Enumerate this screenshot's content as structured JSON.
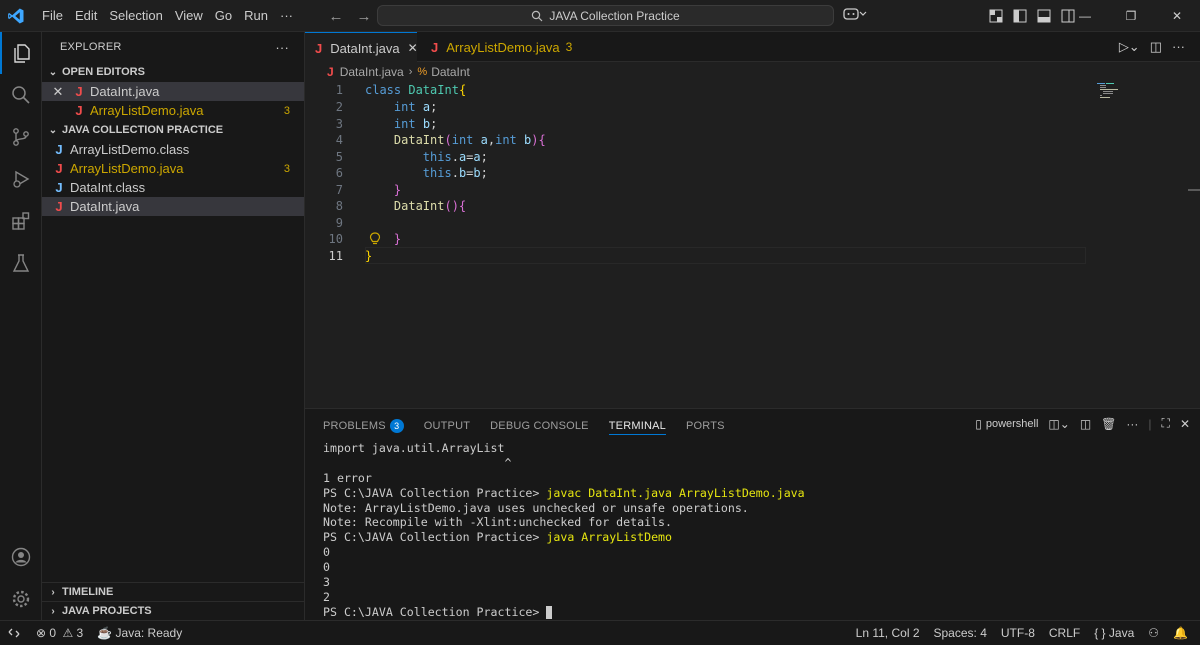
{
  "menu": [
    "File",
    "Edit",
    "Selection",
    "View",
    "Go",
    "Run",
    "···"
  ],
  "command_center": "JAVA Collection Practice",
  "sidebar": {
    "title": "EXPLORER",
    "more": "···",
    "open_editors": {
      "label": "OPEN EDITORS",
      "items": [
        {
          "name": "DataInt.java",
          "close": "✕"
        },
        {
          "name": "ArrayListDemo.java",
          "badge": "3"
        }
      ]
    },
    "workspace": {
      "label": "JAVA COLLECTION PRACTICE",
      "items": [
        {
          "name": "ArrayListDemo.class"
        },
        {
          "name": "ArrayListDemo.java",
          "badge": "3"
        },
        {
          "name": "DataInt.class"
        },
        {
          "name": "DataInt.java"
        }
      ]
    },
    "timeline": "TIMELINE",
    "java_projects": "JAVA PROJECTS"
  },
  "tabs": [
    {
      "label": "DataInt.java",
      "close": "✕"
    },
    {
      "label": "ArrayListDemo.java",
      "badge": "3"
    }
  ],
  "breadcrumbs": {
    "file": "DataInt.java",
    "symbol": "DataInt"
  },
  "code": {
    "line_numbers": [
      "1",
      "2",
      "3",
      "4",
      "5",
      "6",
      "7",
      "8",
      "9",
      "10",
      "11"
    ]
  },
  "panel": {
    "tabs": {
      "problems": "PROBLEMS",
      "problems_count": "3",
      "output": "OUTPUT",
      "debug": "DEBUG CONSOLE",
      "terminal": "TERMINAL",
      "ports": "PORTS"
    },
    "shell": "powershell",
    "terminal": {
      "l1": "import java.util.ArrayList",
      "l2": "                          ^",
      "l3": "1 error",
      "p1": "PS C:\\JAVA Collection Practice> ",
      "c1": "javac DataInt.java ArrayListDemo.java",
      "l5": "Note: ArrayListDemo.java uses unchecked or unsafe operations.",
      "l6": "Note: Recompile with -Xlint:unchecked for details.",
      "p2": "PS C:\\JAVA Collection Practice> ",
      "c2": "java ArrayListDemo",
      "o1": "0",
      "o2": "0",
      "o3": "3",
      "o4": "2",
      "p3": "PS C:\\JAVA Collection Practice> "
    }
  },
  "status": {
    "errors": "0",
    "warnings": "3",
    "java": "Java: Ready",
    "position": "Ln 11, Col 2",
    "spaces": "Spaces: 4",
    "encoding": "UTF-8",
    "eol": "CRLF",
    "language": "Java"
  }
}
